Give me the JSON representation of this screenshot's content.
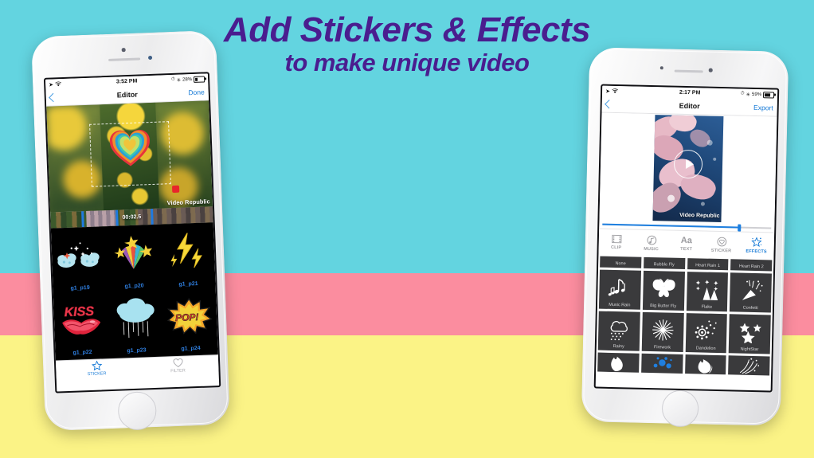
{
  "background": {
    "band_top_color": "#63d4e0",
    "band_mid_color": "#fb8d9f",
    "band_bottom_color": "#fbf386"
  },
  "headline": {
    "line1": "Add Stickers & Effects",
    "line2": "to make unique video",
    "color": "#4a1d8f"
  },
  "watermark": {
    "text": "Video Republic"
  },
  "left_phone": {
    "status": {
      "time": "3:52 PM",
      "battery": "28%"
    },
    "nav": {
      "back_icon": "chevron-left-icon",
      "title": "Editor",
      "action": "Done"
    },
    "preview": {
      "watermark": "Video Republic",
      "sticker": "rainbow-heart-sticker"
    },
    "timeline": {
      "time_label": "00:02.5"
    },
    "stickers": [
      {
        "label": "g1_p19",
        "icon": "clouds-sparkle-sticker"
      },
      {
        "label": "g1_p20",
        "icon": "star-burst-sticker"
      },
      {
        "label": "g1_p21",
        "icon": "lightning-bolt-sticker"
      },
      {
        "label": "g1_p22",
        "icon": "kiss-lips-sticker"
      },
      {
        "label": "g1_p23",
        "icon": "rain-cloud-sticker"
      },
      {
        "label": "g1_p24",
        "icon": "pop-burst-sticker"
      }
    ],
    "tabbar": [
      {
        "label": "STICKER",
        "icon": "star-icon",
        "selected": true
      },
      {
        "label": "FILTER",
        "icon": "heart-icon",
        "selected": false
      }
    ]
  },
  "right_phone": {
    "status": {
      "time": "2:17 PM",
      "battery": "59%"
    },
    "nav": {
      "back_icon": "chevron-left-icon",
      "title": "Editor",
      "action": "Export"
    },
    "preview": {
      "watermark": "Video Republic",
      "play_icon": "play-icon"
    },
    "tabs": [
      {
        "label": "CLIP",
        "icon": "film-icon",
        "selected": false
      },
      {
        "label": "MUSIC",
        "icon": "music-note-icon",
        "selected": false
      },
      {
        "label": "TEXT",
        "icon": "text-aa-icon",
        "selected": false
      },
      {
        "label": "STICKER",
        "icon": "sticker-heart-icon",
        "selected": false
      },
      {
        "label": "EFFECTS",
        "icon": "sparkle-star-icon",
        "selected": true
      }
    ],
    "effects": [
      {
        "label": "None",
        "icon": "none-icon"
      },
      {
        "label": "Bubble Fly",
        "icon": "bubble-icon"
      },
      {
        "label": "Heart Rain 1",
        "icon": "heart-rain-icon"
      },
      {
        "label": "Heart Rain 2",
        "icon": "heart-rain-2-icon"
      },
      {
        "label": "Music Rain",
        "icon": "music-note-icon"
      },
      {
        "label": "Big Butter Fly",
        "icon": "butterfly-icon"
      },
      {
        "label": "Flake",
        "icon": "snowflake-icon"
      },
      {
        "label": "Confetti",
        "icon": "confetti-icon"
      },
      {
        "label": "Rainy",
        "icon": "rain-cloud-icon"
      },
      {
        "label": "Firework",
        "icon": "firework-icon"
      },
      {
        "label": "Dandelion",
        "icon": "dandelion-icon"
      },
      {
        "label": "NightStar",
        "icon": "stars-icon"
      },
      {
        "label": "",
        "icon": "flame-icon"
      },
      {
        "label": "",
        "icon": "blue-bubbles-icon"
      },
      {
        "label": "",
        "icon": "fire-icon"
      },
      {
        "label": "",
        "icon": "sparkler-icon"
      }
    ]
  }
}
